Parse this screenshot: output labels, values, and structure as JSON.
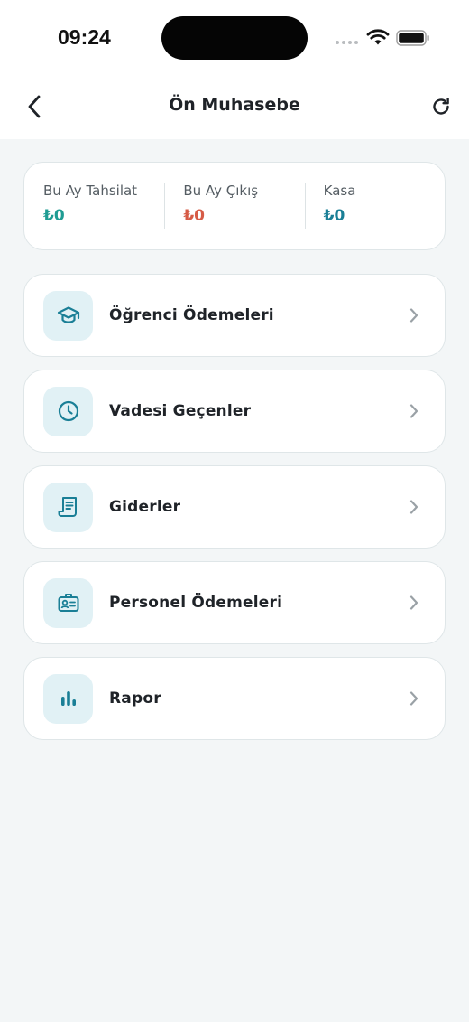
{
  "status_bar": {
    "time": "09:24"
  },
  "header": {
    "title": "Ön Muhasebe"
  },
  "summary": [
    {
      "label": "Bu Ay Tahsilat",
      "value": "₺0",
      "color": "#1f9c93"
    },
    {
      "label": "Bu Ay Çıkış",
      "value": "₺0",
      "color": "#d65b46"
    },
    {
      "label": "Kasa",
      "value": "₺0",
      "color": "#1a7f96"
    }
  ],
  "menu": [
    {
      "label": "Öğrenci Ödemeleri",
      "icon": "graduation-cap-icon"
    },
    {
      "label": "Vadesi Geçenler",
      "icon": "clock-icon"
    },
    {
      "label": "Giderler",
      "icon": "receipt-icon"
    },
    {
      "label": "Personel Ödemeleri",
      "icon": "id-badge-icon"
    },
    {
      "label": "Rapor",
      "icon": "bar-chart-icon"
    }
  ],
  "colors": {
    "accent": "#1a7f96",
    "icon_bg": "#e1f1f5",
    "background": "#f3f6f7"
  }
}
